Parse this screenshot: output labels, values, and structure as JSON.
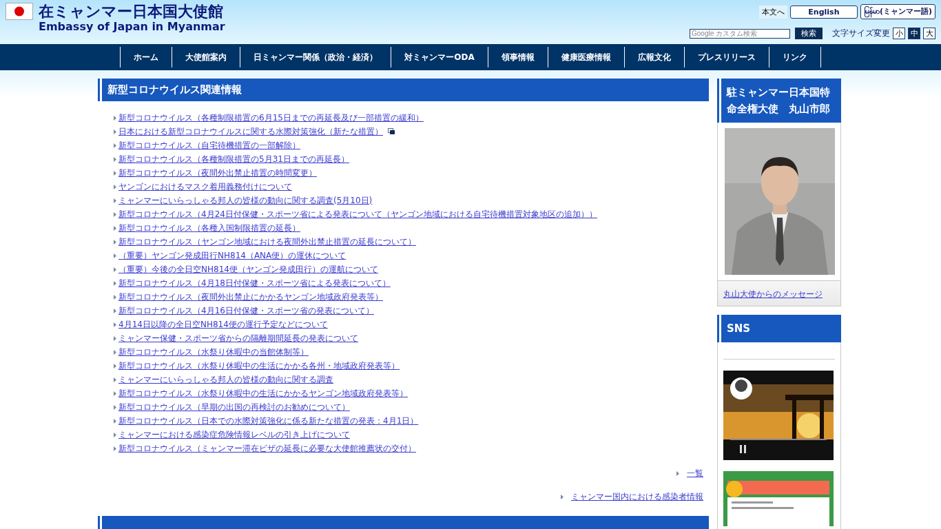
{
  "header": {
    "title": "在ミャンマー日本国大使館",
    "subtitle": "Embassy of Japan in Myanmar",
    "skip_link": "本文へ",
    "languages": [
      "English",
      "မြန်မာ(ミャンマー語)"
    ],
    "search": {
      "placeholder": "Google カスタム検索",
      "button": "検索"
    },
    "font_size": {
      "label": "文字サイズ変更",
      "options": [
        {
          "label": "小",
          "selected": false
        },
        {
          "label": "中",
          "selected": true
        },
        {
          "label": "大",
          "selected": false
        }
      ]
    }
  },
  "nav": [
    "ホーム",
    "大使館案内",
    "日ミャンマー関係（政治・経済）",
    "対ミャンマーODA",
    "領事情報",
    "健康医療情報",
    "広報文化",
    "プレスリリース",
    "リンク"
  ],
  "main": {
    "heading": "新型コロナウイルス関連情報",
    "links": [
      {
        "text": "新型コロナウイルス（各種制限措置の6月15日までの再延長及び一部措置の緩和）",
        "external": false
      },
      {
        "text": "日本における新型コロナウイルスに関する水際対策強化（新たな措置）",
        "external": true
      },
      {
        "text": "新型コロナウイルス（自宅待機措置の一部解除）",
        "external": false
      },
      {
        "text": "新型コロナウイルス（各種制限措置の5月31日までの再延長）",
        "external": false
      },
      {
        "text": "新型コロナウイルス（夜間外出禁止措置の時間変更）",
        "external": false
      },
      {
        "text": "ヤンゴンにおけるマスク着用義務付けについて",
        "external": false
      },
      {
        "text": "ミャンマーにいらっしゃる邦人の皆様の動向に関する調査(5月10日)",
        "external": false
      },
      {
        "text": "新型コロナウイルス（4月24日付保健・スポーツ省による発表について（ヤンゴン地域における自宅待機措置対象地区の追加））",
        "external": false
      },
      {
        "text": "新型コロナウイルス（各種入国制限措置の延長）",
        "external": false
      },
      {
        "text": "新型コロナウイルス（ヤンゴン地域における夜間外出禁止措置の延長について）",
        "external": false
      },
      {
        "text": "（重要）ヤンゴン発成田行NH814（ANA便）の運休について",
        "external": false
      },
      {
        "text": "（重要）今後の全日空NH814便（ヤンゴン発成田行）の運航について",
        "external": false
      },
      {
        "text": "新型コロナウイルス（4月18日付保健・スポーツ省による発表について）",
        "external": false
      },
      {
        "text": "新型コロナウイルス（夜間外出禁止にかかるヤンゴン地域政府発表等）",
        "external": false
      },
      {
        "text": "新型コロナウイルス（4月16日付保健・スポーツ省の発表について）",
        "external": false
      },
      {
        "text": "4月14日以降の全日空NH814便の運行予定などについて",
        "external": false
      },
      {
        "text": "ミャンマー保健・スポーツ省からの隔離期間延長の発表について",
        "external": false
      },
      {
        "text": "新型コロナウイルス（水祭り休暇中の当館体制等）",
        "external": false
      },
      {
        "text": "新型コロナウイルス（水祭り休暇中の生活にかかる各州・地域政府発表等）",
        "external": false
      },
      {
        "text": "ミャンマーにいらっしゃる邦人の皆様の動向に関する調査",
        "external": false
      },
      {
        "text": "新型コロナウイルス（水祭り休暇中の生活にかかるヤンゴン地域政府発表等）",
        "external": false
      },
      {
        "text": "新型コロナウイルス（早期の出国の再検討のお勧めについて）",
        "external": false
      },
      {
        "text": "新型コロナウイルス（日本での水際対策強化に係る新たな措置の発表：4月1日）",
        "external": false
      },
      {
        "text": "ミャンマーにおける感染症危険情報レベルの引き上げについて",
        "external": false
      },
      {
        "text": "新型コロナウイルス（ミャンマー滞在ビザの延長に必要な大使館推薦状の交付）",
        "external": false
      }
    ],
    "more_links": [
      "一覧",
      "ミャンマー国内における感染者情報"
    ]
  },
  "sidebar": {
    "ambassador": {
      "heading": "駐ミャンマー日本国特命全権大使　丸山市郎",
      "link": "丸山大使からのメッセージ"
    },
    "sns": {
      "heading": "SNS"
    }
  }
}
